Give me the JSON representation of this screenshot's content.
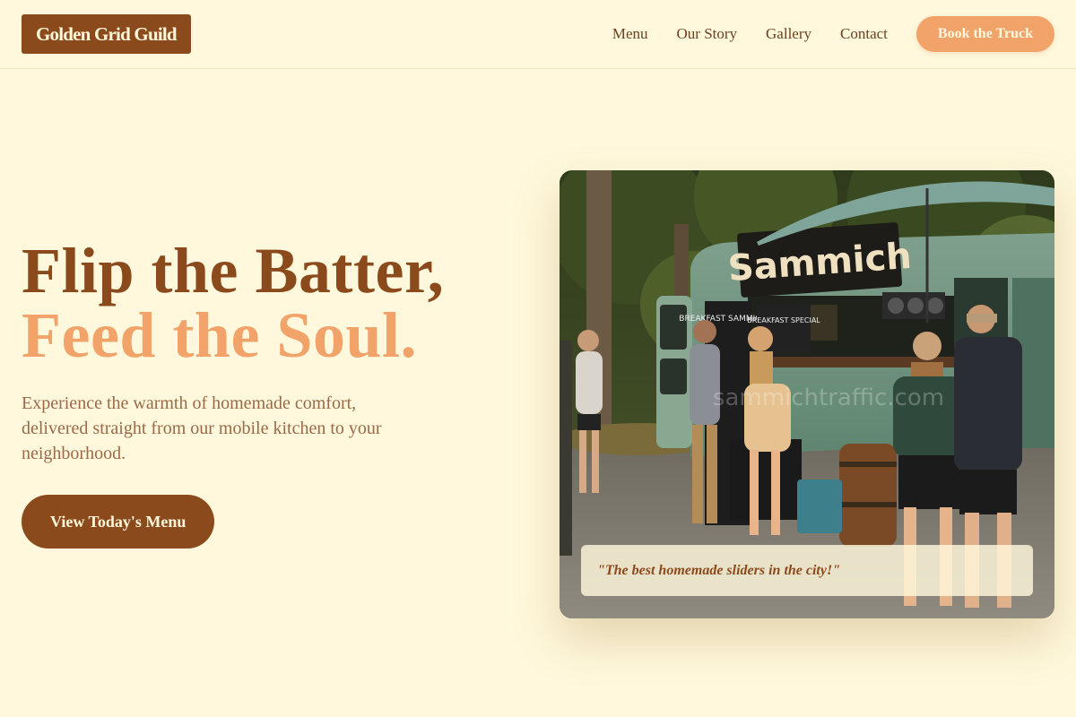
{
  "brand": {
    "name": "Golden Grid Guild"
  },
  "nav": {
    "items": [
      "Menu",
      "Our Story",
      "Gallery",
      "Contact"
    ],
    "cta": "Book the Truck"
  },
  "hero": {
    "title_line1": "Flip the Batter,",
    "title_line2": "Feed the Soul.",
    "subtitle": "Experience the warmth of homemade comfort, delivered straight from our mobile kitchen to your neighborhood.",
    "cta": "View Today's Menu"
  },
  "photo": {
    "truck_sign": "Sammich",
    "board_1": "BREAKFAST SAMMICHES",
    "board_2": "BREAKFAST SPECIAL",
    "watermark": "sammichtraffic.com",
    "quote": "\"The best homemade sliders in the city!\""
  },
  "colors": {
    "background": "#fff8dc",
    "brand_brown": "#8b4a1c",
    "accent_orange": "#f2a36a",
    "body_text": "#9a6a48"
  }
}
